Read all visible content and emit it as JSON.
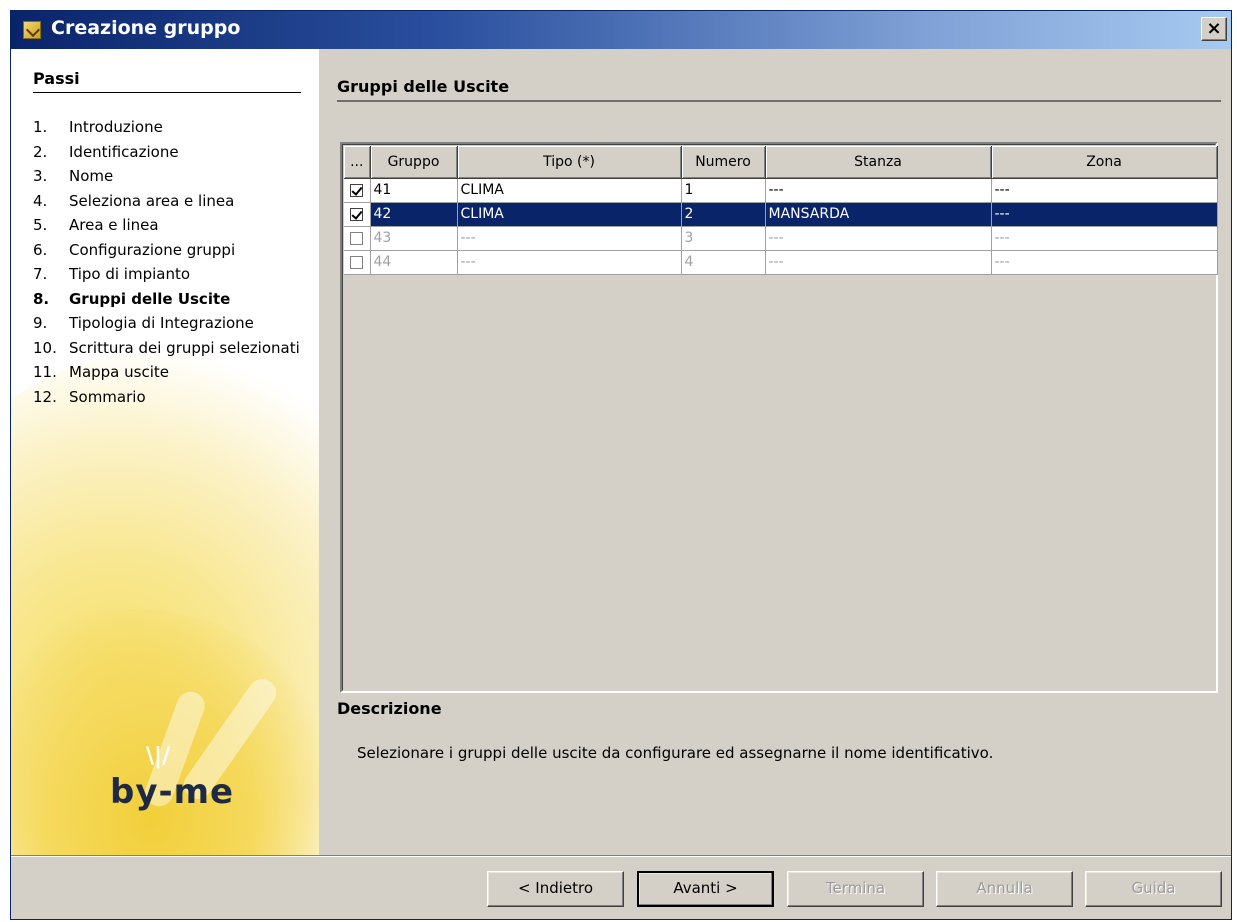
{
  "window": {
    "title": "Creazione gruppo",
    "close_label": "×"
  },
  "sidebar": {
    "title": "Passi",
    "steps": [
      {
        "num": "1.",
        "label": "Introduzione"
      },
      {
        "num": "2.",
        "label": "Identificazione"
      },
      {
        "num": "3.",
        "label": "Nome"
      },
      {
        "num": "4.",
        "label": "Seleziona area e linea"
      },
      {
        "num": "5.",
        "label": "Area e linea"
      },
      {
        "num": "6.",
        "label": "Configurazione gruppi"
      },
      {
        "num": "7.",
        "label": "Tipo di impianto"
      },
      {
        "num": "8.",
        "label": "Gruppi delle Uscite"
      },
      {
        "num": "9.",
        "label": "Tipologia di Integrazione"
      },
      {
        "num": "10.",
        "label": "Scrittura dei gruppi selezionati"
      },
      {
        "num": "11.",
        "label": "Mappa uscite"
      },
      {
        "num": "12.",
        "label": "Sommario"
      }
    ],
    "active_step": 8,
    "logo_text": "by-me"
  },
  "main": {
    "title": "Gruppi delle Uscite",
    "table": {
      "columns": [
        "...",
        "Gruppo",
        "Tipo (*)",
        "Numero",
        "Stanza",
        "Zona"
      ],
      "rows": [
        {
          "checked": true,
          "gruppo": "41",
          "tipo": "CLIMA",
          "numero": "1",
          "stanza": "---",
          "zona": "---"
        },
        {
          "checked": true,
          "gruppo": "42",
          "tipo": "CLIMA",
          "numero": "2",
          "stanza": "MANSARDA",
          "zona": "---"
        },
        {
          "checked": false,
          "gruppo": "43",
          "tipo": "---",
          "numero": "3",
          "stanza": "---",
          "zona": "---"
        },
        {
          "checked": false,
          "gruppo": "44",
          "tipo": "---",
          "numero": "4",
          "stanza": "---",
          "zona": "---"
        }
      ],
      "selected_row": 2
    },
    "description_title": "Descrizione",
    "description_text": "Selezionare i gruppi delle uscite da configurare ed assegnarne il nome identificativo."
  },
  "buttons": {
    "back": "< Indietro",
    "next": "Avanti >",
    "finish": "Termina",
    "cancel": "Annulla",
    "help": "Guida"
  }
}
